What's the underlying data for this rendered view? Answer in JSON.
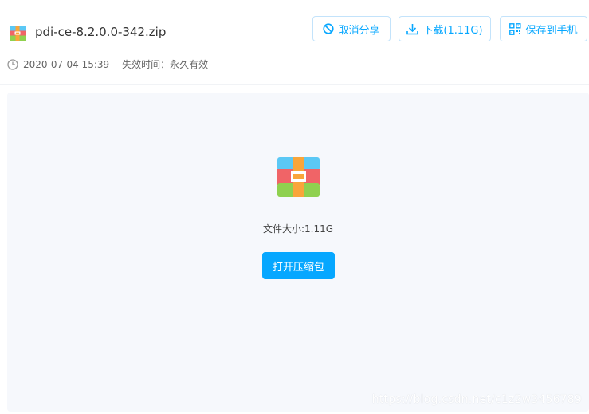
{
  "file": {
    "name": "pdi-ce-8.2.0.0-342.zip",
    "date": "2020-07-04 15:39",
    "expiry_label": "失效时间：永久有效",
    "size_label": "文件大小:1.11G"
  },
  "actions": {
    "cancel_share": "取消分享",
    "download": "下载(1.11G)",
    "save_to_phone": "保存到手机",
    "open_archive": "打开压缩包"
  },
  "watermark": "https://blog.csdn.net/c1z2w3456789",
  "icons": [
    "zip-file-icon",
    "ban-icon",
    "download-icon",
    "qr-code-icon",
    "clock-icon"
  ],
  "colors": {
    "accent": "#06a7ff",
    "button_border": "#c3e3fb",
    "panel_bg": "#f6f8fc",
    "zip_blue": "#5bc8f5",
    "zip_red": "#f06467",
    "zip_green": "#8fd14f",
    "zip_orange": "#f9a53a"
  }
}
